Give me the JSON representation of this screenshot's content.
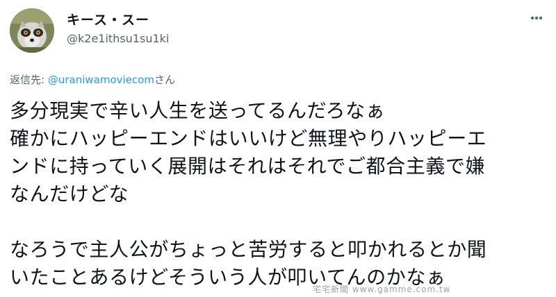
{
  "user": {
    "display_name": "キース・スー",
    "handle": "@k2e1ithsu1su1ki"
  },
  "reply": {
    "prefix": "返信先: ",
    "mention": "@uraniwamoviecom",
    "suffix": "さん"
  },
  "tweet_lines": [
    "多分現実で辛い人生を送ってるんだろなぁ",
    "確かにハッピーエンドはいいけど無理やりハッピーエ",
    "ンドに持っていく展開はそれはそれでご都合主義で嫌",
    "なんだけどな",
    "",
    "なろうで主人公がちょっと苦労すると叩かれるとか聞",
    "いたことあるけどそういう人が叩いてんのかなぁ"
  ],
  "watermark": "宅宅新聞 www.gamme.com.tw",
  "icons": {
    "avatar": "lemur-avatar",
    "more": "more-icon"
  }
}
